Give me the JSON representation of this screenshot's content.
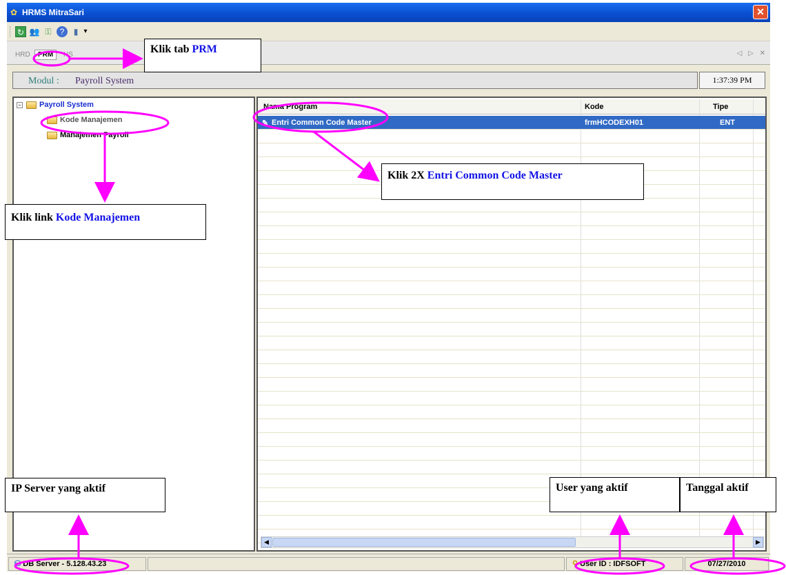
{
  "window": {
    "title": "HRMS MitraSari",
    "close_label": "✕"
  },
  "toolbar": {
    "icons": [
      "refresh-icon",
      "users-icon",
      "key-icon",
      "help-icon",
      "exit-icon"
    ],
    "dropdown": "▾"
  },
  "tabs": {
    "items": [
      "HRD",
      "PRM",
      "HS"
    ],
    "active": "PRM",
    "nav": "◁ ▷ ✕"
  },
  "module": {
    "label": "Modul :",
    "value": "Payroll System",
    "time": "1:37:39 PM"
  },
  "tree": {
    "root": "Payroll System",
    "children": [
      "Kode Manajemen",
      "Manajemen Payroll"
    ]
  },
  "grid": {
    "columns": [
      "Nama Program",
      "Kode",
      "Tipe"
    ],
    "rows": [
      {
        "nama": "Entri  Common Code Master",
        "kode": "frmHCODEXH01",
        "tipe": "ENT"
      }
    ]
  },
  "status": {
    "db_server": "DB Server - 5.128.43.23",
    "user_id": "User ID : IDFSOFT",
    "date": "07/27/2010"
  },
  "annotations": {
    "tab": {
      "prefix": "Klik tab ",
      "highlight": "PRM"
    },
    "tree": {
      "prefix": "Klik link ",
      "highlight": "Kode Manajemen"
    },
    "grid": {
      "prefix": "Klik 2X ",
      "highlight": "Entri Common Code Master"
    },
    "ip": "IP Server yang aktif",
    "user": "User yang aktif",
    "date": "Tanggal aktif"
  },
  "colors": {
    "accent": "#ff00ff",
    "selection": "#316ac5",
    "highlight_text": "#1212e6"
  }
}
